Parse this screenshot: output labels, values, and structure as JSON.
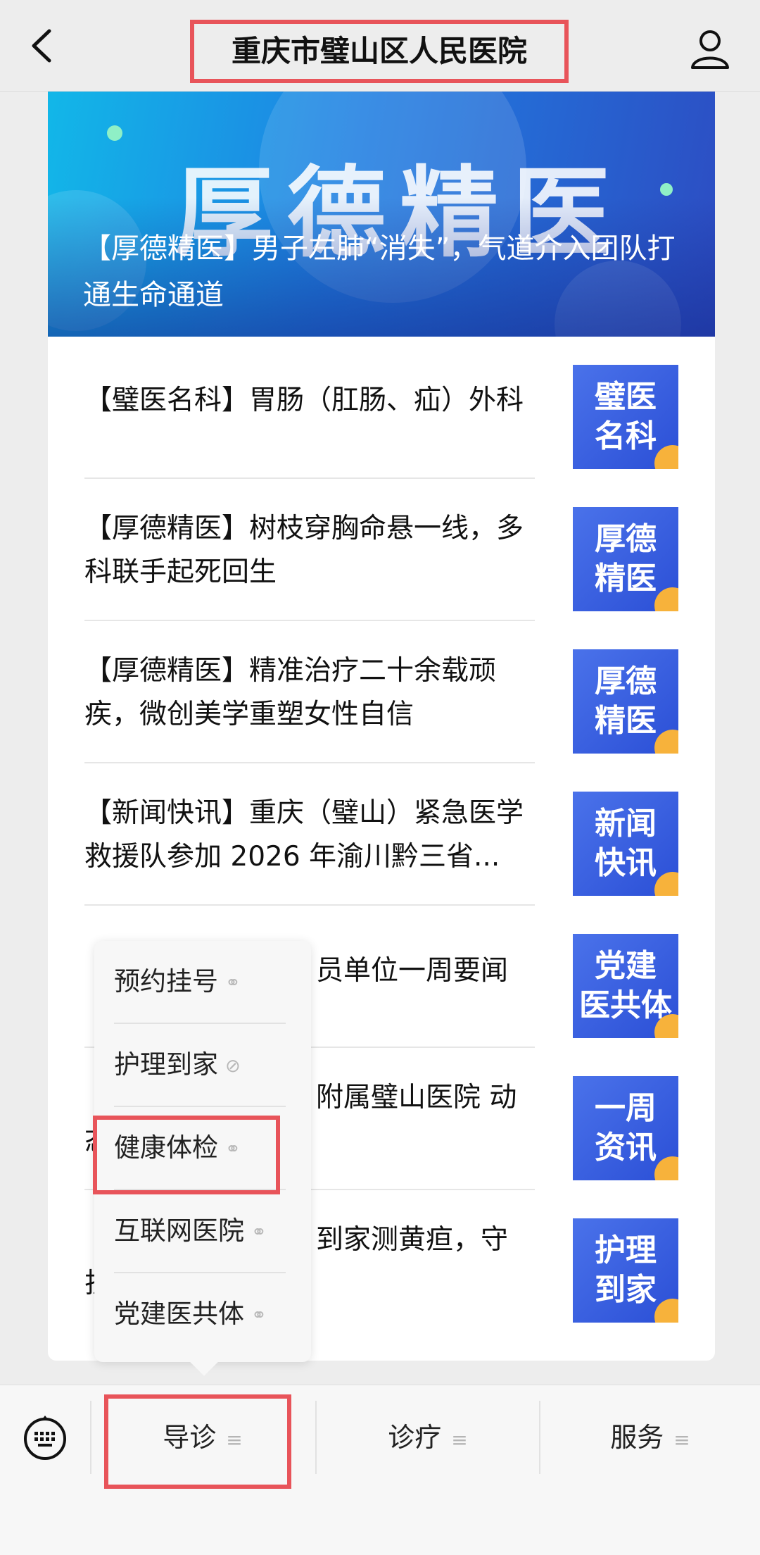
{
  "header": {
    "title": "重庆市璧山区人民医院",
    "back_icon": "chevron-left-icon",
    "user_icon": "person-icon"
  },
  "banner": {
    "big_text": "厚德精医",
    "caption": "【厚德精医】男子左肺“消失”，气道介入团队打通生命通道"
  },
  "articles": [
    {
      "title": "【璧医名科】胃肠（肛肠、疝）外科",
      "thumb": "璧医 名科"
    },
    {
      "title": "【厚德精医】树枝穿胸命悬一线，多科联手起死回生",
      "thumb": "厚德 精医"
    },
    {
      "title": "【厚德精医】精准治疗二十余载顽疾，微创美学重塑女性自信",
      "thumb": "厚德 精医"
    },
    {
      "title": "【新闻快讯】重庆（璧山）紧急医学救援队参加 2026 年渝川黔三省...",
      "thumb": "新闻 快讯"
    },
    {
      "title": "【",
      "title_tail": "员单位一周要闻",
      "thumb": "党建 医共体"
    },
    {
      "title": "【",
      "title_tail": "附属璧山医院 动",
      "title_line2": "态",
      "thumb": "一周 资讯"
    },
    {
      "title": "【",
      "title_tail": "到家测黄疸，守",
      "title_line2": "护",
      "thumb": "护理 到家"
    }
  ],
  "popup_menu": [
    {
      "label": "预约挂号",
      "icon": "link-icon"
    },
    {
      "label": "护理到家",
      "icon": "miniprogram-icon"
    },
    {
      "label": "健康体检",
      "icon": "link-icon"
    },
    {
      "label": "互联网医院",
      "icon": "link-icon"
    },
    {
      "label": "党建医共体",
      "icon": "link-icon"
    }
  ],
  "bottom_tabs": [
    {
      "label": "导诊",
      "icon": "menu-icon"
    },
    {
      "label": "诊疗",
      "icon": "menu-icon"
    },
    {
      "label": "服务",
      "icon": "menu-icon"
    }
  ],
  "keyboard_icon": "keyboard-icon",
  "colors": {
    "highlight": "#e8545a",
    "thumb_blue": "#3a62e0",
    "thumb_accent": "#f7b23b",
    "background": "#ededed"
  }
}
